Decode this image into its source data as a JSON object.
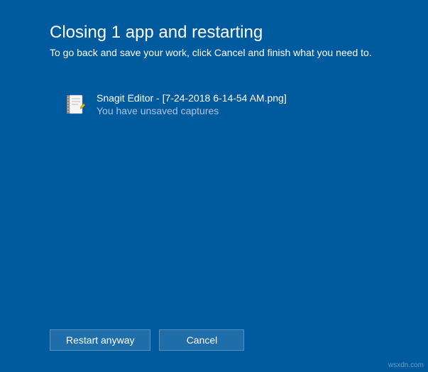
{
  "header": {
    "title": "Closing 1 app and restarting",
    "subtitle": "To go back and save your work, click Cancel and finish what you need to."
  },
  "apps": [
    {
      "name": "Snagit Editor - [7-24-2018 6-14-54 AM.png]",
      "status": "You have unsaved captures",
      "icon": "notepad-icon"
    }
  ],
  "buttons": {
    "restart": "Restart anyway",
    "cancel": "Cancel"
  },
  "watermark": "wsxdn.com"
}
